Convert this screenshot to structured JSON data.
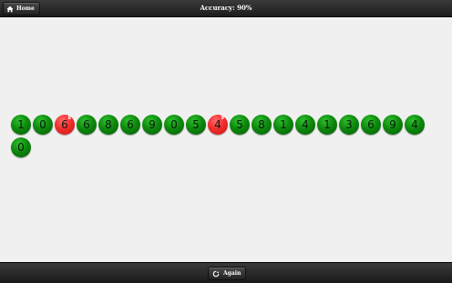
{
  "header": {
    "home_label": "Home",
    "home_icon": "home-icon",
    "accuracy_text": "Accuracy: 90%"
  },
  "digits": [
    {
      "value": "1",
      "status": "correct"
    },
    {
      "value": "0",
      "status": "correct"
    },
    {
      "value": "6",
      "status": "wrong",
      "correction": "8"
    },
    {
      "value": "6",
      "status": "correct"
    },
    {
      "value": "8",
      "status": "correct"
    },
    {
      "value": "6",
      "status": "correct"
    },
    {
      "value": "9",
      "status": "correct"
    },
    {
      "value": "0",
      "status": "correct"
    },
    {
      "value": "5",
      "status": "correct"
    },
    {
      "value": "4",
      "status": "wrong",
      "correction": "9"
    },
    {
      "value": "5",
      "status": "correct"
    },
    {
      "value": "8",
      "status": "correct"
    },
    {
      "value": "1",
      "status": "correct"
    },
    {
      "value": "4",
      "status": "correct"
    },
    {
      "value": "1",
      "status": "correct"
    },
    {
      "value": "3",
      "status": "correct"
    },
    {
      "value": "6",
      "status": "correct"
    },
    {
      "value": "9",
      "status": "correct"
    },
    {
      "value": "4",
      "status": "correct"
    },
    {
      "value": "0",
      "status": "correct"
    }
  ],
  "colors": {
    "correct": "#0e8a0e",
    "wrong": "#f22d2d",
    "background": "#f0f0f0",
    "bar": "#1c1c1c"
  },
  "footer": {
    "again_label": "Again",
    "again_icon": "refresh-icon"
  }
}
